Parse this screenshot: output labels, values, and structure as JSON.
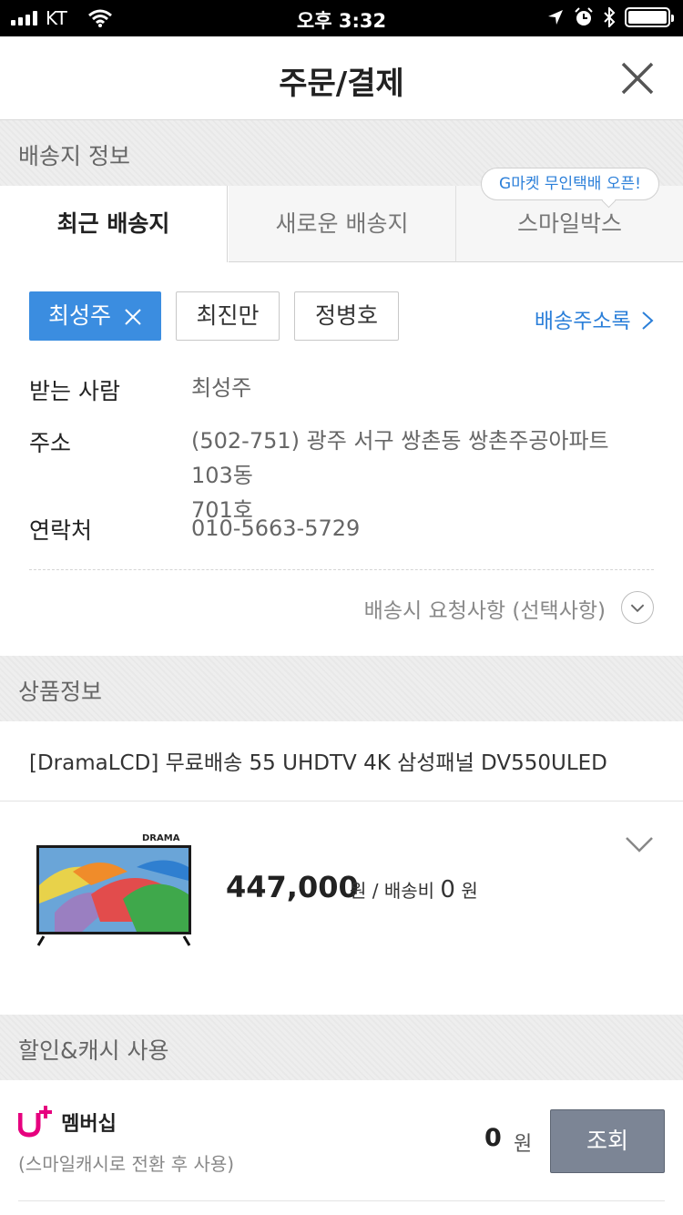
{
  "status_bar": {
    "carrier": "KT",
    "time": "오후 3:32"
  },
  "header": {
    "title": "주문/결제"
  },
  "shipping": {
    "section_label": "배송지 정보",
    "tabs": [
      {
        "label": "최근 배송지",
        "active": true
      },
      {
        "label": "새로운 배송지",
        "active": false
      },
      {
        "label": "스마일박스",
        "active": false
      }
    ],
    "tooltip": "G마켓 무인택배 오픈!",
    "chips": [
      {
        "label": "최성주",
        "selected": true
      },
      {
        "label": "최진만",
        "selected": false
      },
      {
        "label": "정병호",
        "selected": false
      }
    ],
    "address_book_link": "배송주소록",
    "receiver_label": "받는 사람",
    "receiver_value": "최성주",
    "address_label": "주소",
    "address_line1": "(502-751) 광주 서구 쌍촌동 쌍촌주공아파트 103동",
    "address_line2": "701호",
    "contact_label": "연락처",
    "contact_value": "010-5663-5729",
    "request_label": "배송시 요청사항 (선택사항)"
  },
  "product": {
    "section_label": "상품정보",
    "title": "[DramaLCD] 무료배송 55 UHDTV 4K 삼성패널 DV550ULED",
    "brand": "DRAMA",
    "price": "447,000",
    "price_unit": "원 / 배송비",
    "shipping_fee": "0",
    "fee_unit": "원"
  },
  "discount": {
    "section_label": "할인&캐시 사용",
    "uplus_name": "멤버십",
    "uplus_note": "(스마일캐시로 전환 후 사용)",
    "amount": "0",
    "unit": "원",
    "lookup_button": "조회"
  },
  "colors": {
    "accent": "#3b8de0",
    "link": "#2b7fd9",
    "uplus": "#e6007e",
    "button_gray": "#7c8595"
  }
}
